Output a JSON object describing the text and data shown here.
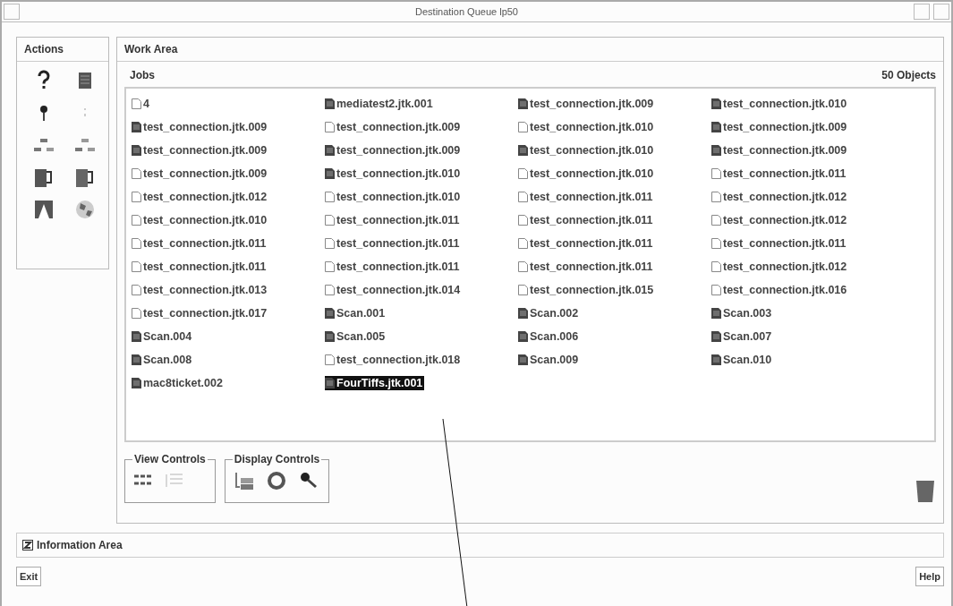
{
  "window": {
    "title": "Destination Queue lp50"
  },
  "actions": {
    "title": "Actions"
  },
  "work_area": {
    "title": "Work Area",
    "jobs_label": "Jobs",
    "count": "50 Objects",
    "jobs": [
      {
        "name": "4",
        "kind": "blank",
        "selected": false
      },
      {
        "name": "mediatest2.jtk.001",
        "kind": "filled",
        "selected": false
      },
      {
        "name": "test_connection.jtk.009",
        "kind": "filled",
        "selected": false
      },
      {
        "name": "test_connection.jtk.010",
        "kind": "filled",
        "selected": false
      },
      {
        "name": "test_connection.jtk.009",
        "kind": "filled",
        "selected": false
      },
      {
        "name": "test_connection.jtk.009",
        "kind": "blank",
        "selected": false
      },
      {
        "name": "test_connection.jtk.010",
        "kind": "blank",
        "selected": false
      },
      {
        "name": "test_connection.jtk.009",
        "kind": "filled",
        "selected": false
      },
      {
        "name": "test_connection.jtk.009",
        "kind": "filled",
        "selected": false
      },
      {
        "name": "test_connection.jtk.009",
        "kind": "filled",
        "selected": false
      },
      {
        "name": "test_connection.jtk.010",
        "kind": "filled",
        "selected": false
      },
      {
        "name": "test_connection.jtk.009",
        "kind": "filled",
        "selected": false
      },
      {
        "name": "test_connection.jtk.009",
        "kind": "blank",
        "selected": false
      },
      {
        "name": "test_connection.jtk.010",
        "kind": "filled",
        "selected": false
      },
      {
        "name": "test_connection.jtk.010",
        "kind": "blank",
        "selected": false
      },
      {
        "name": "test_connection.jtk.011",
        "kind": "blank",
        "selected": false
      },
      {
        "name": "test_connection.jtk.012",
        "kind": "blank",
        "selected": false
      },
      {
        "name": "test_connection.jtk.010",
        "kind": "blank",
        "selected": false
      },
      {
        "name": "test_connection.jtk.011",
        "kind": "blank",
        "selected": false
      },
      {
        "name": "test_connection.jtk.012",
        "kind": "blank",
        "selected": false
      },
      {
        "name": "test_connection.jtk.010",
        "kind": "blank",
        "selected": false
      },
      {
        "name": "test_connection.jtk.011",
        "kind": "blank",
        "selected": false
      },
      {
        "name": "test_connection.jtk.011",
        "kind": "blank",
        "selected": false
      },
      {
        "name": "test_connection.jtk.012",
        "kind": "blank",
        "selected": false
      },
      {
        "name": "test_connection.jtk.011",
        "kind": "blank",
        "selected": false
      },
      {
        "name": "test_connection.jtk.011",
        "kind": "blank",
        "selected": false
      },
      {
        "name": "test_connection.jtk.011",
        "kind": "blank",
        "selected": false
      },
      {
        "name": "test_connection.jtk.011",
        "kind": "blank",
        "selected": false
      },
      {
        "name": "test_connection.jtk.011",
        "kind": "blank",
        "selected": false
      },
      {
        "name": "test_connection.jtk.011",
        "kind": "blank",
        "selected": false
      },
      {
        "name": "test_connection.jtk.011",
        "kind": "blank",
        "selected": false
      },
      {
        "name": "test_connection.jtk.012",
        "kind": "blank",
        "selected": false
      },
      {
        "name": "test_connection.jtk.013",
        "kind": "blank",
        "selected": false
      },
      {
        "name": "test_connection.jtk.014",
        "kind": "blank",
        "selected": false
      },
      {
        "name": "test_connection.jtk.015",
        "kind": "blank",
        "selected": false
      },
      {
        "name": "test_connection.jtk.016",
        "kind": "blank",
        "selected": false
      },
      {
        "name": "test_connection.jtk.017",
        "kind": "blank",
        "selected": false
      },
      {
        "name": "Scan.001",
        "kind": "filled",
        "selected": false
      },
      {
        "name": "Scan.002",
        "kind": "filled",
        "selected": false
      },
      {
        "name": "Scan.003",
        "kind": "filled",
        "selected": false
      },
      {
        "name": "Scan.004",
        "kind": "filled",
        "selected": false
      },
      {
        "name": "Scan.005",
        "kind": "filled",
        "selected": false
      },
      {
        "name": "Scan.006",
        "kind": "filled",
        "selected": false
      },
      {
        "name": "Scan.007",
        "kind": "filled",
        "selected": false
      },
      {
        "name": "Scan.008",
        "kind": "filled",
        "selected": false
      },
      {
        "name": "test_connection.jtk.018",
        "kind": "blank",
        "selected": false
      },
      {
        "name": "Scan.009",
        "kind": "filled",
        "selected": false
      },
      {
        "name": "Scan.010",
        "kind": "filled",
        "selected": false
      },
      {
        "name": "mac8ticket.002",
        "kind": "filled",
        "selected": false
      },
      {
        "name": "FourTiffs.jtk.001",
        "kind": "filled",
        "selected": true
      }
    ],
    "view_controls": {
      "title": "View Controls"
    },
    "display_controls": {
      "title": "Display Controls"
    }
  },
  "information_area": {
    "label": "Information Area"
  },
  "buttons": [
    {
      "label": "Exit"
    },
    {
      "label": "Help"
    }
  ]
}
